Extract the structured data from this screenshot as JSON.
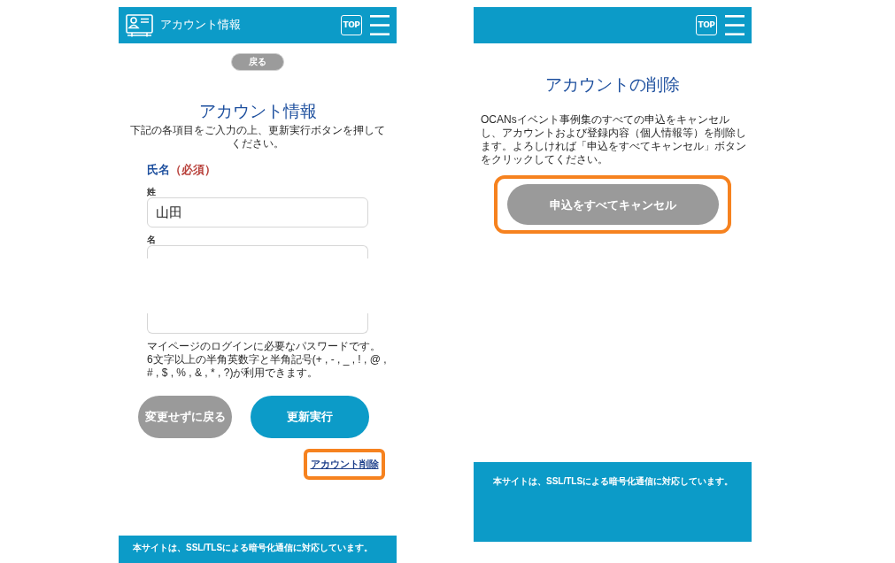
{
  "account_screen": {
    "header": {
      "title": "アカウント情報",
      "top_label": "TOP"
    },
    "back_button": "戻る",
    "heading": "アカウント情報",
    "description": "下記の各項目をご入力の上、更新実行ボタンを押してください。",
    "name_group": {
      "label": "氏名",
      "required": "（必須）"
    },
    "fields": [
      {
        "kind": "text",
        "label": "姓",
        "value": "山田"
      },
      {
        "kind": "clipped_top",
        "label": "名"
      },
      {
        "kind": "clipped_bottom"
      }
    ],
    "help_texts": [
      "マイページのログインに必要なパスワードです。",
      "6文字以上の半角英数字と半角記号(+ , - , _ , ! , @ , # , $ , % , & , * , ?)が利用できます。"
    ],
    "actions": [
      {
        "kind": "secondary",
        "label": "変更せずに戻る"
      },
      {
        "kind": "primary",
        "label": "更新実行"
      }
    ],
    "delete_link": {
      "label": "アカウント削除",
      "highlighted": true
    },
    "footer": "本サイトは、SSL/TLSによる暗号化通信に対応しています。"
  },
  "delete_screen": {
    "header": {
      "top_label": "TOP"
    },
    "heading": "アカウントの削除",
    "description": "OCANsイベント事例集のすべての申込をキャンセルし、アカウントおよび登録内容（個人情報等）を削除します。よろしければ「申込をすべてキャンセル」ボタンをクリックしてください。",
    "cancel_button": {
      "label": "申込をすべてキャンセル",
      "highlighted": true
    },
    "footer": "本サイトは、SSL/TLSによる暗号化通信に対応しています。"
  }
}
